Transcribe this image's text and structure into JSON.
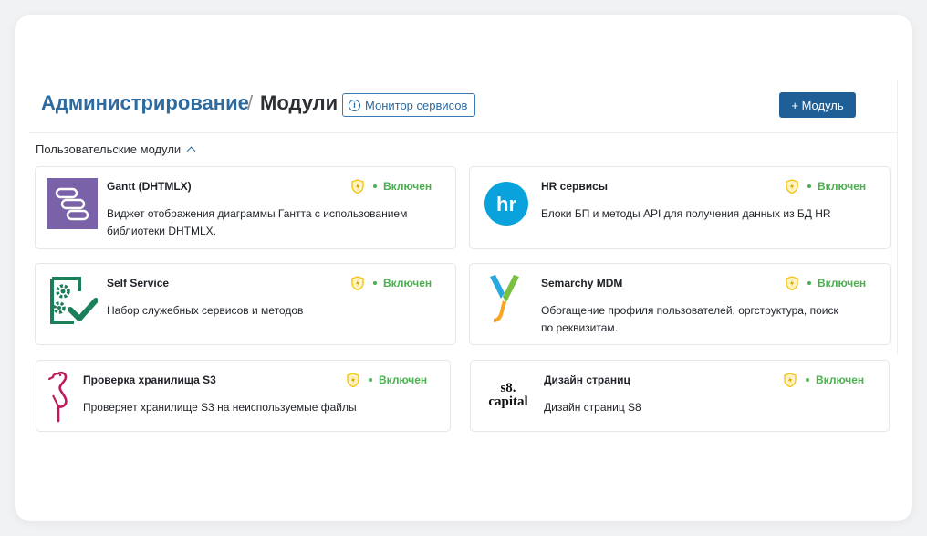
{
  "breadcrumb": {
    "root": "Администрирование",
    "separator": "/",
    "current": "Модули"
  },
  "header": {
    "monitor_label": "Монитор сервисов",
    "add_label": "+ Модуль"
  },
  "section": {
    "title": "Пользовательские модули"
  },
  "modules": [
    {
      "title": "Gantt (DHTMLX)",
      "desc": "Виджет отображения диаграммы Гантта с использованием библиотеки DHTMLX.",
      "status": "Включен",
      "icon": "gantt-logo"
    },
    {
      "title": "HR сервисы",
      "desc": "Блоки БП и методы API для получения данных из БД HR",
      "status": "Включен",
      "icon": "hr-logo",
      "logo_text": "hr"
    },
    {
      "title": "Self Service",
      "desc": "Набор служебных сервисов и методов",
      "status": "Включен",
      "icon": "self-service-logo"
    },
    {
      "title": "Semarchy MDM",
      "desc": "Обогащение профиля пользователей, оргструктура, поиск по реквизитам.",
      "status": "Включен",
      "icon": "semarchy-logo"
    },
    {
      "title": "Проверка хранилища S3",
      "desc": "Проверяет хранилище S3 на неиспользуемые файлы",
      "status": "Включен",
      "icon": "flamingo-logo"
    },
    {
      "title": "Дизайн страниц",
      "desc": "Дизайн страниц S8",
      "status": "Включен",
      "icon": "s8-capital-logo",
      "logo_text": [
        "s8.",
        "capital"
      ]
    }
  ],
  "colors": {
    "brand_blue": "#1f5f96",
    "link_blue": "#2d6a9f",
    "status_green": "#4caf50",
    "shield_yellow": "#f5c518"
  }
}
